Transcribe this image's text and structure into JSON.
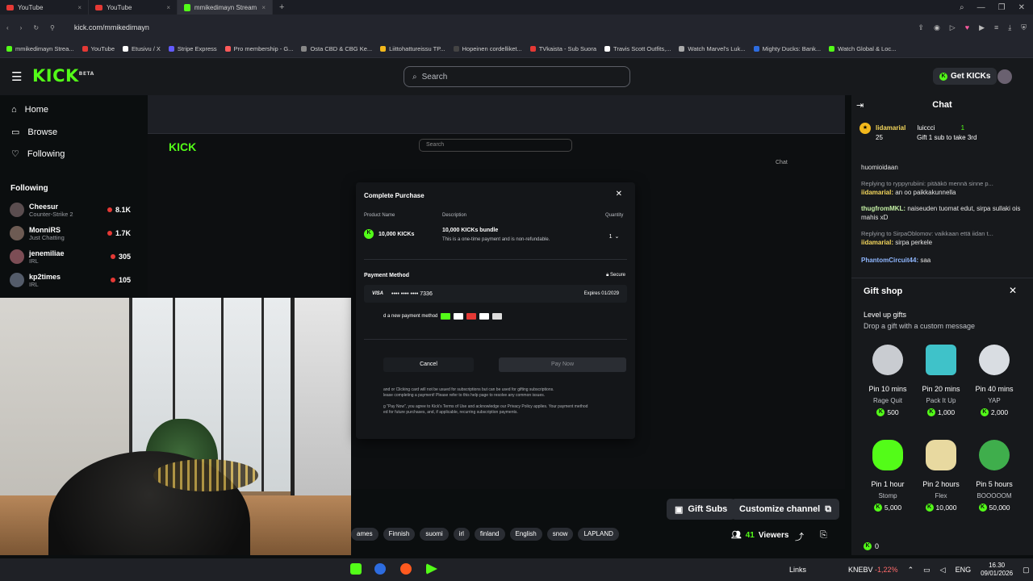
{
  "browser": {
    "tabs": [
      {
        "label": "YouTube",
        "icon": "youtube-icon"
      },
      {
        "label": "YouTube",
        "icon": "youtube-icon"
      },
      {
        "label": "mmikedimayn Stream - V",
        "icon": "kick-icon"
      }
    ],
    "url": "kick.com/mmikedimayn",
    "bookmarks": [
      "mmikedimayn Strea...",
      "YouTube",
      "Etusivu / X",
      "Stripe Express",
      "Pro membership - G...",
      "Osta CBD & CBG Ke...",
      "Liittohattureissu TP...",
      "Hopeinen cordelliket...",
      "TVkaista - Sub Suora",
      "Travis Scott Outfits,...",
      "Watch Marvel's Luk...",
      "Mighty Ducks: Bank...",
      "Watch Global & Loc..."
    ]
  },
  "header": {
    "logo": "KICK",
    "logo_sup": "BETA",
    "search_placeholder": "Search",
    "get_kicks": "Get KICKs"
  },
  "sidebar": {
    "nav": [
      {
        "label": "Home",
        "icon": "home-icon"
      },
      {
        "label": "Browse",
        "icon": "browse-icon"
      },
      {
        "label": "Following",
        "icon": "heart-icon"
      }
    ],
    "following_title": "Following",
    "following": [
      {
        "name": "Cheesur",
        "category": "Counter-Strike 2",
        "viewers": "8.1K"
      },
      {
        "name": "MonniRS",
        "category": "Just Chatting",
        "viewers": "1.7K"
      },
      {
        "name": "jenemiliae",
        "category": "IRL",
        "viewers": "305"
      },
      {
        "name": "kp2times",
        "category": "IRL",
        "viewers": "105"
      }
    ]
  },
  "modal": {
    "title": "Complete Purchase",
    "headers": {
      "product": "Product Name",
      "description": "Description",
      "quantity": "Quantity"
    },
    "product": "10,000 KICKs",
    "description_title": "10,000 KICKs bundle",
    "description_text": "This is a one-time payment and is non-refundable.",
    "quantity": "1",
    "payment_method": "Payment Method",
    "secure": "Secure",
    "card_brand": "VISA",
    "card_number": "•••• •••• •••• 7336",
    "card_expires": "Expires  01/2029",
    "add_new": "d a new payment method",
    "cancel": "Cancel",
    "pay_now": "Pay Now",
    "legal1": "and or Clicking card will not be usued for subscriptions but can be used for gifting subscriptions.",
    "legal2": "lease completing a payment! Please refer to this help page to resolve any common issues.",
    "legal3": "g \"Pay Now\", you agree to Kick's Terms of Use and acknowledge our Privacy Policy applies. Your payment method",
    "legal4": "ed for future purchases, and, if applicable, recurring subscription payments."
  },
  "stream_bar": {
    "gift_subs": "Gift Subs",
    "customize": "Customize channel",
    "tags": [
      "ames",
      "Finnish",
      "suomi",
      "irl",
      "finland",
      "English",
      "snow",
      "LAPLAND"
    ],
    "viewers_num": "41",
    "viewers_label": "Viewers"
  },
  "chat": {
    "title": "Chat",
    "pinned_user": "lidamarial",
    "pinned_count": "25",
    "pinned_gifter": "luiccci",
    "pinned_gift_count": "1",
    "pinned_text": "Gift 1 sub to take 3rd",
    "messages": [
      {
        "reply": "",
        "user": "",
        "text": "huomioidaan"
      },
      {
        "reply": "Replying to ryppyrubiini: pitääkö mennä sinne p...",
        "user": "iidamarial:",
        "text": "an oo paikkakunnella"
      },
      {
        "reply": "",
        "user": "thugfromMKL:",
        "text": "naiseuden tuomat edut, sirpa sullaki ois mahis xD"
      },
      {
        "reply": "Replying to SirpaOblomov: vaikkaan että iidan t...",
        "user": "iidamarial:",
        "text": "sirpa perkele"
      },
      {
        "reply": "",
        "user": "PhantomCircuit44:",
        "text": "saa"
      }
    ]
  },
  "giftshop": {
    "title": "Gift shop",
    "subtitle": "Level up gifts",
    "description": "Drop a gift with a custom message",
    "gifts": [
      {
        "duration": "Pin 10 mins",
        "name": "Rage Quit",
        "price": "500",
        "color": "#c9ccd1"
      },
      {
        "duration": "Pin 20 mins",
        "name": "Pack It Up",
        "price": "1,000",
        "color": "#3fc2c9"
      },
      {
        "duration": "Pin 40 mins",
        "name": "YAP",
        "price": "2,000",
        "color": "#d9dde2"
      },
      {
        "duration": "Pin 1 hour",
        "name": "Stomp",
        "price": "5,000",
        "color": "#53fc18"
      },
      {
        "duration": "Pin 2 hours",
        "name": "Flex",
        "price": "10,000",
        "color": "#e8d9a0"
      },
      {
        "duration": "Pin 5 hours",
        "name": "BOOOOOM",
        "price": "50,000",
        "color": "#3fae4c"
      }
    ],
    "balance": "0"
  },
  "taskbar": {
    "links": "Links",
    "ticker": "KNEBV",
    "change": "-1,22%",
    "lang": "ENG",
    "time": "16.30",
    "date": "09/01/2026"
  }
}
